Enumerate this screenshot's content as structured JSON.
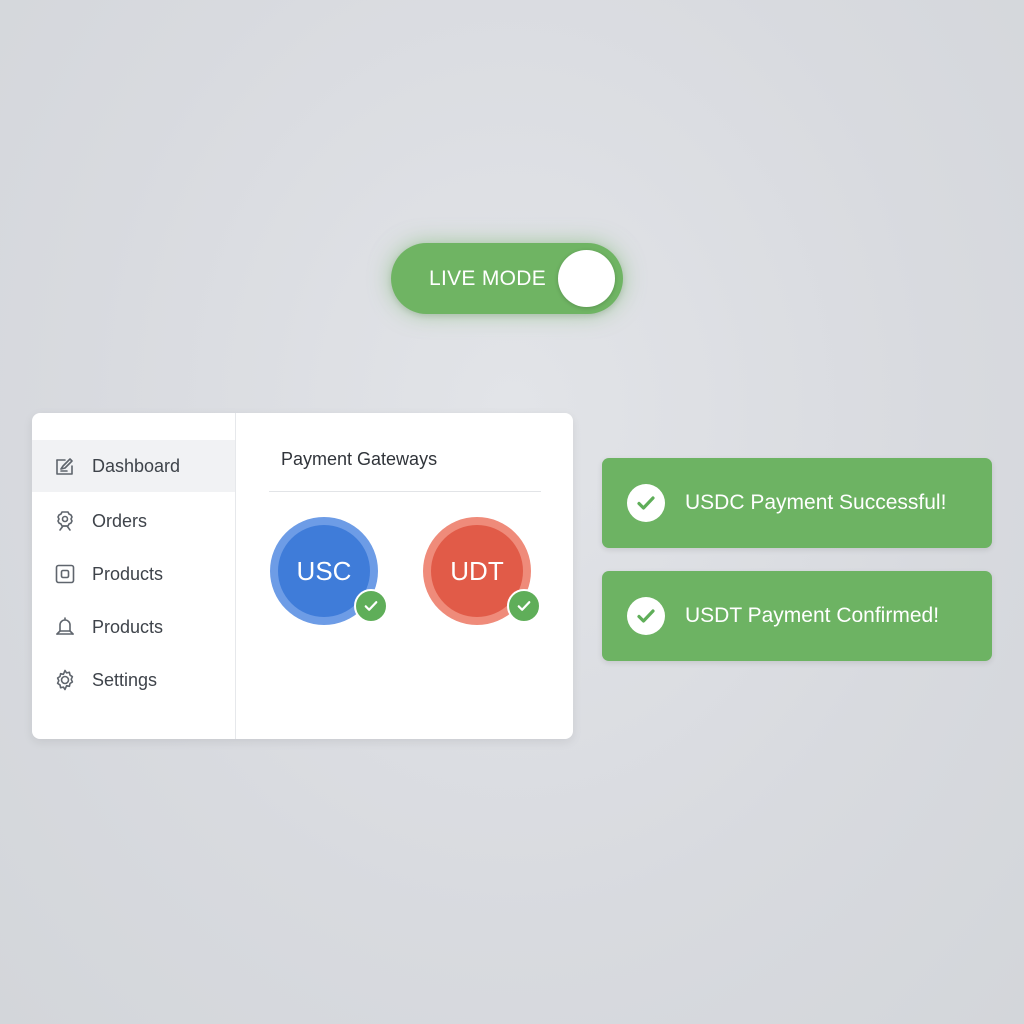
{
  "live_toggle": {
    "label": "LIVE MODE",
    "state": "on",
    "color": "#6fb463"
  },
  "sidebar": {
    "items": [
      {
        "label": "Dashboard",
        "icon": "edit-icon",
        "active": true
      },
      {
        "label": "Orders",
        "icon": "gear-box-icon",
        "active": false
      },
      {
        "label": "Products",
        "icon": "square-box-icon",
        "active": false
      },
      {
        "label": "Products",
        "icon": "bell-icon",
        "active": false
      },
      {
        "label": "Settings",
        "icon": "gear-icon",
        "active": false
      }
    ]
  },
  "main": {
    "title": "Payment Gateways",
    "gateways": [
      {
        "label": "USC",
        "color": "#3f7cd9",
        "verified": true
      },
      {
        "label": "UDT",
        "color": "#e15b48",
        "verified": true
      }
    ]
  },
  "toasts": [
    {
      "text": "USDC Payment Successful!",
      "icon": "check-circle-icon"
    },
    {
      "text": "USDT Payment Confirmed!",
      "icon": "check-circle-icon"
    }
  ],
  "colors": {
    "success": "#6db363",
    "background": "#d8dadf"
  }
}
